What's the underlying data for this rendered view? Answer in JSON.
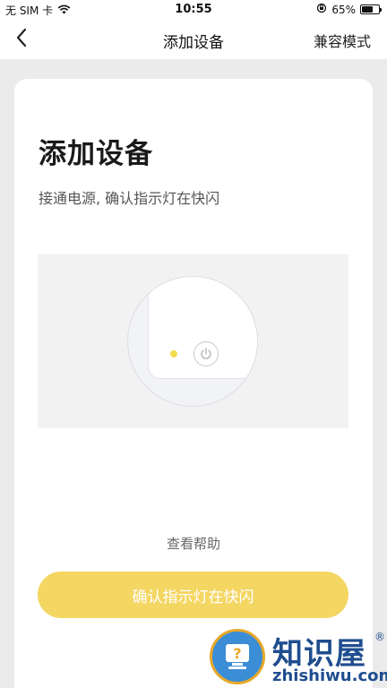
{
  "status_bar": {
    "carrier": "无 SIM 卡",
    "time": "10:55",
    "battery_percent": "65%",
    "battery_level": 0.65
  },
  "nav": {
    "back_icon": "chevron-left-icon",
    "title": "添加设备",
    "action_label": "兼容模式"
  },
  "main": {
    "title": "添加设备",
    "subtitle": "接通电源, 确认指示灯在快闪",
    "illustration": {
      "led_color": "#f1dc4e"
    },
    "help_link": "查看帮助",
    "confirm_button": "确认指示灯在快闪"
  },
  "watermark": {
    "text": "知识屋",
    "registered": "®",
    "url": "zhishiwu.com"
  },
  "colors": {
    "accent": "#f4d663",
    "background": "#ebebeb"
  }
}
